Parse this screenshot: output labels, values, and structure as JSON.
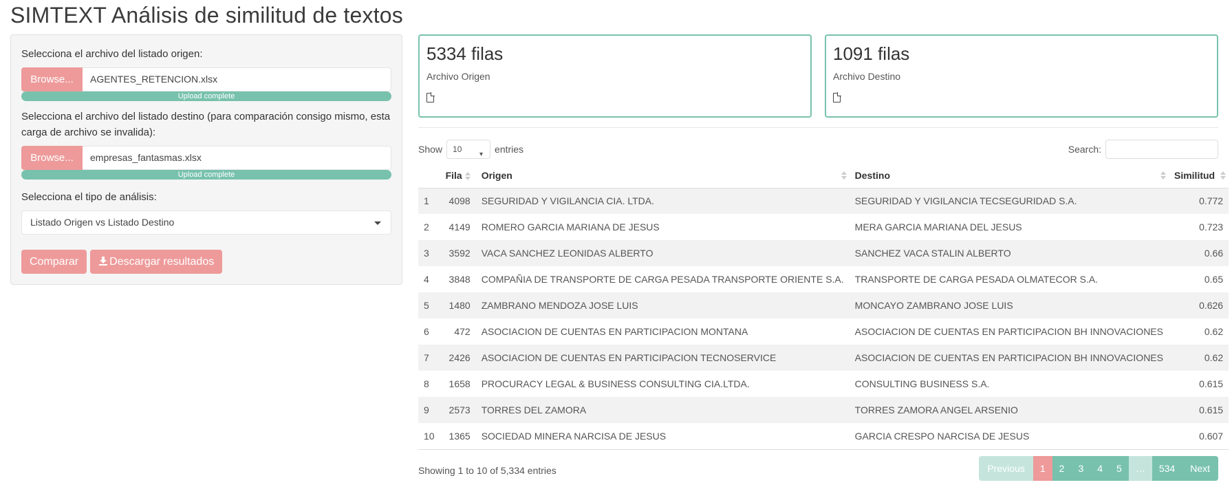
{
  "app_title": "SIMTEXT Análisis de similitud de textos",
  "sidebar": {
    "origin_label": "Selecciona el archivo del listado origen:",
    "origin_browse": "Browse...",
    "origin_file": "AGENTES_RETENCION.xlsx",
    "origin_progress": "Upload complete",
    "origin_progress_percent": 100,
    "dest_label": "Selecciona el archivo del listado destino (para comparación consigo mismo, esta carga de archivo se invalida):",
    "dest_browse": "Browse...",
    "dest_file": "empresas_fantasmas.xlsx",
    "dest_progress": "Upload complete",
    "dest_progress_percent": 100,
    "analysis_label": "Selecciona el tipo de análisis:",
    "analysis_selected": "Listado Origen vs Listado Destino",
    "compare_button": "Comparar",
    "download_button": "Descargar resultados"
  },
  "value_boxes": [
    {
      "value": "5334 filas",
      "subtitle": "Archivo Origen",
      "icon": "file-icon"
    },
    {
      "value": "1091 filas",
      "subtitle": "Archivo Destino",
      "icon": "file-icon"
    }
  ],
  "table_controls": {
    "show_label": "Show",
    "length_value": "10",
    "entries_label": "entries",
    "search_label": "Search:",
    "search_value": ""
  },
  "table": {
    "columns": [
      "",
      "Fila",
      "Origen",
      "Destino",
      "Similitud"
    ],
    "rows": [
      [
        "1",
        "4098",
        "SEGURIDAD Y VIGILANCIA CIA. LTDA.",
        "SEGURIDAD Y VIGILANCIA TECSEGURIDAD S.A.",
        "0.772"
      ],
      [
        "2",
        "4149",
        "ROMERO GARCIA MARIANA DE JESUS",
        "MERA GARCIA MARIANA DEL JESUS",
        "0.723"
      ],
      [
        "3",
        "3592",
        "VACA SANCHEZ LEONIDAS ALBERTO",
        "SANCHEZ VACA STALIN ALBERTO",
        "0.66"
      ],
      [
        "4",
        "3848",
        "COMPAÑIA DE TRANSPORTE DE CARGA PESADA TRANSPORTE ORIENTE S.A.",
        "TRANSPORTE DE CARGA PESADA OLMATECOR S.A.",
        "0.65"
      ],
      [
        "5",
        "1480",
        "ZAMBRANO MENDOZA JOSE LUIS",
        "MONCAYO ZAMBRANO JOSE LUIS",
        "0.626"
      ],
      [
        "6",
        "472",
        "ASOCIACION DE CUENTAS EN PARTICIPACION MONTANA",
        "ASOCIACION DE CUENTAS EN PARTICIPACION BH INNOVACIONES",
        "0.62"
      ],
      [
        "7",
        "2426",
        "ASOCIACION DE CUENTAS EN PARTICIPACION TECNOSERVICE",
        "ASOCIACION DE CUENTAS EN PARTICIPACION BH INNOVACIONES",
        "0.62"
      ],
      [
        "8",
        "1658",
        "PROCURACY LEGAL & BUSINESS CONSULTING CIA.LTDA.",
        "CONSULTING BUSINESS S.A.",
        "0.615"
      ],
      [
        "9",
        "2573",
        "TORRES DEL ZAMORA",
        "TORRES ZAMORA ANGEL ARSENIO",
        "0.615"
      ],
      [
        "10",
        "1365",
        "SOCIEDAD MINERA NARCISA DE JESUS",
        "GARCIA CRESPO NARCISA DE JESUS",
        "0.607"
      ]
    ]
  },
  "footer": {
    "info": "Showing 1 to 10 of 5,334 entries",
    "pagination": [
      "Previous",
      "1",
      "2",
      "3",
      "4",
      "5",
      "…",
      "534",
      "Next"
    ],
    "current_page": "1"
  },
  "colors": {
    "accent_pink": "#ee9a9a",
    "accent_green": "#78c2ad"
  }
}
